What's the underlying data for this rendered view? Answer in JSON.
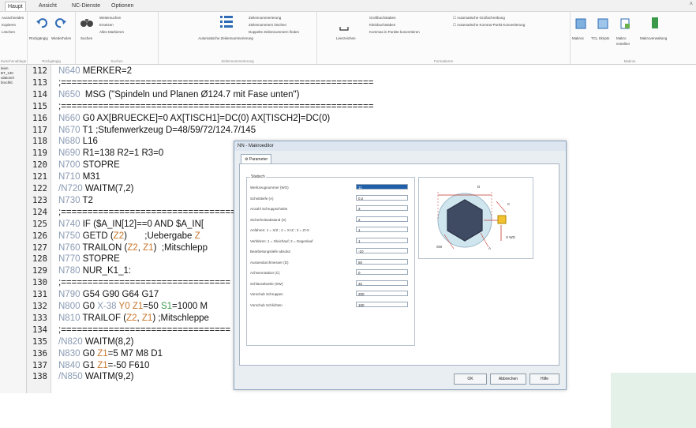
{
  "tabs": [
    "Haupt",
    "Ansicht",
    "NC-Dienste",
    "Optionen"
  ],
  "ribbon": {
    "clipboard": {
      "label": "Zwischenablage",
      "items": [
        "Ausschneiden",
        "Kopieren",
        "Löschen"
      ]
    },
    "undo": {
      "label": "Rückgängig",
      "undo": "Rückgängig",
      "redo": "Wiederholen"
    },
    "search": {
      "label": "Suchen",
      "find": "Suchen",
      "items": [
        "Weitersuchen",
        "Ersetzen",
        "Alles Markieren"
      ]
    },
    "numbering": {
      "label": "Zeilennummerierung",
      "auto": "Automatische Zeilennummerierung",
      "items": [
        "Zeilennummerierung",
        "Zeilennummern löschen",
        "Doppelte Zeilennummern finden"
      ]
    },
    "format": {
      "label": "Formatieren",
      "space": "Leerzeichen",
      "items": [
        "Großbuchstaben",
        "Kleinbuchstaben",
        "Kommas in Punkte konvertieren"
      ],
      "checks": [
        "Automatische Großschreibung",
        "Automatische Komma-Punkt Konvertierung"
      ]
    },
    "macros": {
      "label": "Makros",
      "items": [
        "Makros",
        "TCL Skripts",
        "Makro erstellen",
        "Makroverwaltung"
      ]
    }
  },
  "sidebar": [
    "leien",
    "BT_130",
    "ulationel",
    "bruchkl."
  ],
  "lines": [
    {
      "n": "112",
      "c": [
        [
          "nn",
          "N640"
        ],
        [
          "t",
          " MERKER=2"
        ]
      ]
    },
    {
      "n": "113",
      "c": [
        [
          "t",
          ";==========================================================="
        ]
      ]
    },
    {
      "n": "114",
      "c": [
        [
          "nn",
          "N650"
        ],
        [
          "t",
          "  MSG (\"Spindeln und Planen Ø124.7 mit Fase unten\")"
        ]
      ]
    },
    {
      "n": "115",
      "c": [
        [
          "t",
          ";==========================================================="
        ]
      ]
    },
    {
      "n": "116",
      "c": [
        [
          "nn",
          "N660"
        ],
        [
          "t",
          " G0 AX[BRUECKE]=0 AX[TISCH1]=DC(0) AX[TISCH2]=DC(0)"
        ]
      ]
    },
    {
      "n": "117",
      "c": [
        [
          "nn",
          "N670"
        ],
        [
          "t",
          " T1 ;Stufenwerkzeug D=48/59/72/124.7/145"
        ]
      ]
    },
    {
      "n": "118",
      "c": [
        [
          "nn",
          "N680"
        ],
        [
          "t",
          " L16"
        ]
      ]
    },
    {
      "n": "119",
      "c": [
        [
          "nn",
          "N690"
        ],
        [
          "t",
          " R1=138 R2=1 R3=0"
        ]
      ]
    },
    {
      "n": "120",
      "c": [
        [
          "nn",
          "N700"
        ],
        [
          "t",
          " STOPRE"
        ]
      ]
    },
    {
      "n": "121",
      "c": [
        [
          "nn",
          "N710"
        ],
        [
          "t",
          " M31"
        ]
      ]
    },
    {
      "n": "122",
      "c": [
        [
          "nn",
          "/N720"
        ],
        [
          "t",
          " WAITM(7,2)"
        ]
      ]
    },
    {
      "n": "123",
      "c": [
        [
          "nn",
          "N730"
        ],
        [
          "t",
          " T2"
        ]
      ]
    },
    {
      "n": "124",
      "c": [
        [
          "t",
          ";==========================================================="
        ]
      ]
    },
    {
      "n": "125",
      "c": [
        [
          "nn",
          "N740"
        ],
        [
          "t",
          " IF ($A_IN[12]==0 AND $A_IN["
        ]
      ]
    },
    {
      "n": "126",
      "c": [
        [
          "nn",
          "N750"
        ],
        [
          "t",
          " GETD ("
        ],
        [
          "zv",
          "Z2"
        ],
        [
          "t",
          ")       ;Uebergabe "
        ],
        [
          "zv",
          "Z"
        ]
      ]
    },
    {
      "n": "127",
      "c": [
        [
          "nn",
          "N760"
        ],
        [
          "t",
          " TRAILON ("
        ],
        [
          "zv",
          "Z2"
        ],
        [
          "t",
          ", "
        ],
        [
          "zv",
          "Z1"
        ],
        [
          "t",
          ")  ;Mitschlepp"
        ]
      ]
    },
    {
      "n": "128",
      "c": [
        [
          "nn",
          "N770"
        ],
        [
          "t",
          " STOPRE"
        ]
      ]
    },
    {
      "n": "129",
      "c": [
        [
          "nn",
          "N780"
        ],
        [
          "t",
          " NUR_K1_1:"
        ]
      ]
    },
    {
      "n": "130",
      "c": [
        [
          "t",
          ";================================"
        ]
      ]
    },
    {
      "n": "131",
      "c": [
        [
          "nn",
          "N790"
        ],
        [
          "t",
          " G54 G90 G64 G17"
        ]
      ]
    },
    {
      "n": "132",
      "c": [
        [
          "nn",
          "N800"
        ],
        [
          "t",
          " G0 "
        ],
        [
          "nn",
          "X-38"
        ],
        [
          "t",
          " "
        ],
        [
          "zv",
          "Y0"
        ],
        [
          "t",
          " "
        ],
        [
          "zv",
          "Z1"
        ],
        [
          "t",
          "=50 "
        ],
        [
          "sv",
          "S1"
        ],
        [
          "t",
          "=1000 M"
        ]
      ]
    },
    {
      "n": "133",
      "c": [
        [
          "nn",
          "N810"
        ],
        [
          "t",
          " TRAILOF ("
        ],
        [
          "zv",
          "Z2"
        ],
        [
          "t",
          ", "
        ],
        [
          "zv",
          "Z1"
        ],
        [
          "t",
          ") ;Mitschleppe"
        ]
      ]
    },
    {
      "n": "134",
      "c": [
        [
          "t",
          ";================================"
        ]
      ]
    },
    {
      "n": "135",
      "c": [
        [
          "nn",
          "/N820"
        ],
        [
          "t",
          " WAITM(8,2)"
        ]
      ]
    },
    {
      "n": "136",
      "c": [
        [
          "nn",
          "N830"
        ],
        [
          "t",
          " G0 "
        ],
        [
          "zv",
          "Z1"
        ],
        [
          "t",
          "=5 M7 M8 D1"
        ]
      ]
    },
    {
      "n": "137",
      "c": [
        [
          "nn",
          "N840"
        ],
        [
          "t",
          " G1 "
        ],
        [
          "zv",
          "Z1"
        ],
        [
          "t",
          "=-50 F610"
        ]
      ]
    },
    {
      "n": "138",
      "c": [
        [
          "nn",
          "/N850"
        ],
        [
          "t",
          " WAITM(9,2)"
        ]
      ]
    }
  ],
  "dialog": {
    "title": "NN - Makroeditor",
    "tab": "Parameter",
    "group": "Statisch",
    "params": [
      {
        "label": "Werkzeugnummer (WO)",
        "value": "11",
        "selected": true
      },
      {
        "label": "Schnitttiefe (A)",
        "value": "0.2"
      },
      {
        "label": "Anzahl Schruppschnitte",
        "value": "3"
      },
      {
        "label": "Sicherheitsabstand (S)",
        "value": "2"
      },
      {
        "label": "Anfahren: 1 = X/Z ; 2 = X>Z ; 3 = Z>X",
        "value": "1"
      },
      {
        "label": "Verfahren: 1 = Gleichauf; 2 = Gegenlauf",
        "value": "1"
      },
      {
        "label": "Bearbeitungstiefe absolut",
        "value": "-10"
      },
      {
        "label": "Aussendurchmesser (D)",
        "value": "50"
      },
      {
        "label": "Achsenrotation (C)",
        "value": "0"
      },
      {
        "label": "Schlüsselweite (SW)",
        "value": "32"
      },
      {
        "label": "Vorschub Schruppen",
        "value": "200"
      },
      {
        "label": "Vorschub Schlichten",
        "value": "150"
      }
    ],
    "diagram_labels": {
      "d": "D",
      "c": "C",
      "sw": "SW",
      "a": "A",
      "swd": "S WD"
    },
    "buttons": {
      "ok": "OK",
      "cancel": "Abbrechen",
      "help": "Hilfe"
    }
  }
}
